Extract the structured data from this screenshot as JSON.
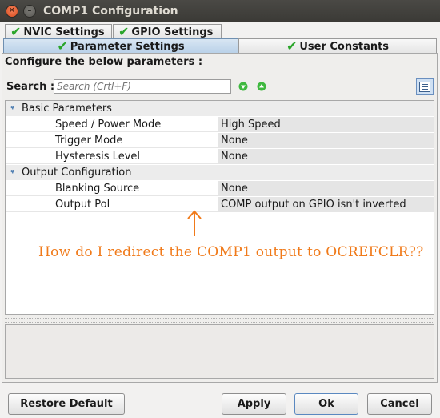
{
  "window": {
    "title": "COMP1 Configuration"
  },
  "tabs": [
    {
      "label": "NVIC Settings"
    },
    {
      "label": "GPIO Settings"
    },
    {
      "label": "Parameter Settings"
    },
    {
      "label": "User Constants"
    }
  ],
  "panel": {
    "heading": "Configure the below parameters :"
  },
  "search": {
    "label": "Search :",
    "placeholder": "Search (Crtl+F)"
  },
  "groups": [
    {
      "label": "Basic Parameters",
      "params": [
        {
          "name": "Speed / Power Mode",
          "value": "High Speed"
        },
        {
          "name": "Trigger Mode",
          "value": "None"
        },
        {
          "name": "Hysteresis Level",
          "value": "None"
        }
      ]
    },
    {
      "label": "Output Configuration",
      "params": [
        {
          "name": "Blanking Source",
          "value": "None"
        },
        {
          "name": "Output Pol",
          "value": "COMP output on GPIO isn't inverted"
        }
      ]
    }
  ],
  "annotation": {
    "text": "How do I redirect the COMP1 output to OCREFCLR??",
    "color": "#f07a1a"
  },
  "buttons": {
    "restore_default": "Restore Default",
    "apply": "Apply",
    "ok": "Ok",
    "cancel": "Cancel"
  },
  "icons": {
    "close": "close-icon",
    "minimize": "minimize-icon",
    "check": "check-icon",
    "next": "arrow-down-icon",
    "prev": "arrow-up-icon",
    "list": "list-view-icon"
  }
}
